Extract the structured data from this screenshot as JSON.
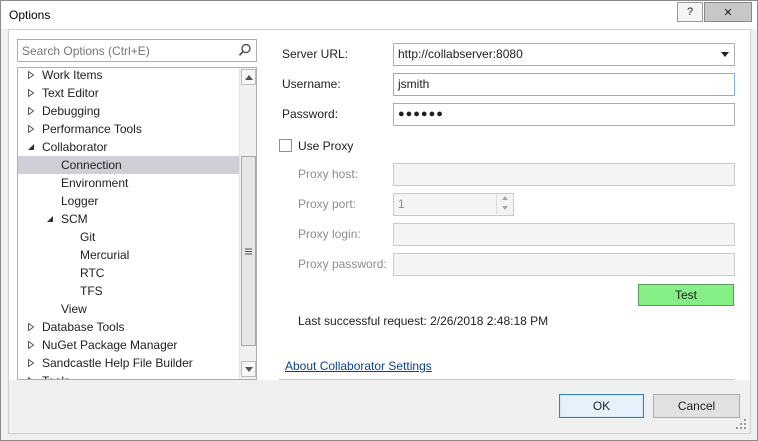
{
  "window": {
    "title": "Options",
    "help_label": "?",
    "close_label": "✕"
  },
  "search": {
    "placeholder": "Search Options (Ctrl+E)",
    "icon": "search-icon"
  },
  "tree": {
    "items": [
      {
        "label": "Work Items",
        "expander": "collapsed",
        "selected": false
      },
      {
        "label": "Text Editor",
        "expander": "collapsed",
        "selected": false
      },
      {
        "label": "Debugging",
        "expander": "collapsed",
        "selected": false
      },
      {
        "label": "Performance Tools",
        "expander": "collapsed",
        "selected": false
      },
      {
        "label": "Collaborator",
        "expander": "expanded",
        "selected": false
      },
      {
        "label": "Connection",
        "expander": "none",
        "selected": true
      },
      {
        "label": "Environment",
        "expander": "none",
        "selected": false
      },
      {
        "label": "Logger",
        "expander": "none",
        "selected": false
      },
      {
        "label": "SCM",
        "expander": "expanded",
        "selected": false
      },
      {
        "label": "Git",
        "expander": "none",
        "selected": false
      },
      {
        "label": "Mercurial",
        "expander": "none",
        "selected": false
      },
      {
        "label": "RTC",
        "expander": "none",
        "selected": false
      },
      {
        "label": "TFS",
        "expander": "none",
        "selected": false
      },
      {
        "label": "View",
        "expander": "none",
        "selected": false
      },
      {
        "label": "Database Tools",
        "expander": "collapsed",
        "selected": false
      },
      {
        "label": "NuGet Package Manager",
        "expander": "collapsed",
        "selected": false
      },
      {
        "label": "Sandcastle Help File Builder",
        "expander": "collapsed",
        "selected": false
      },
      {
        "label": "Tools",
        "expander": "collapsed",
        "selected": false
      }
    ]
  },
  "form": {
    "server_url_label": "Server URL:",
    "server_url_value": "http://collabserver:8080",
    "username_label": "Username:",
    "username_value": "jsmith",
    "password_label": "Password:",
    "password_value": "●●●●●●",
    "use_proxy_label": "Use Proxy",
    "use_proxy_checked": false,
    "proxy_host_label": "Proxy host:",
    "proxy_host_value": "",
    "proxy_port_label": "Proxy port:",
    "proxy_port_value": "1",
    "proxy_login_label": "Proxy login:",
    "proxy_login_value": "",
    "proxy_password_label": "Proxy password:",
    "proxy_password_value": "",
    "test_label": "Test",
    "test_color": "#85ee85",
    "last_request": "Last successful request: 2/26/2018 2:48:18 PM",
    "about_link": "About Collaborator Settings"
  },
  "footer": {
    "ok_label": "OK",
    "cancel_label": "Cancel"
  }
}
